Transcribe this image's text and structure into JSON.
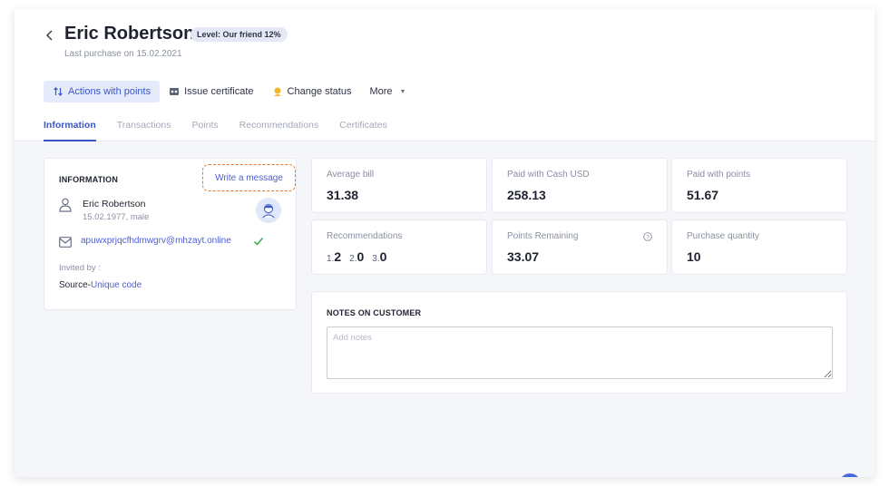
{
  "customer": {
    "name": "Eric Robertson",
    "level": "Level: Our friend 12%",
    "last_purchase": "Last purchase on 15.02.2021"
  },
  "actions": [
    {
      "label": "Actions with points",
      "icon": "sort-arrows-icon"
    },
    {
      "label": "Issue certificate",
      "icon": "certificate-icon"
    },
    {
      "label": "Change status",
      "icon": "status-icon"
    },
    {
      "label": "More",
      "icon": "caret-down-icon"
    }
  ],
  "tabs": [
    {
      "label": "Information",
      "active": true
    },
    {
      "label": "Transactions"
    },
    {
      "label": "Points"
    },
    {
      "label": "Recommendations"
    },
    {
      "label": "Certificates"
    }
  ],
  "info": {
    "title": "INFORMATION",
    "write_message": "Write a message",
    "name": "Eric Robertson",
    "dob_gender": "15.02.1977, male",
    "email": "apuwxprjqcfhdmwgrv@mhzayt.online",
    "invited_by": "Invited by :",
    "source_prefix": "Source-",
    "source_link": "Unique code"
  },
  "stats": {
    "average_bill": {
      "label": "Average bill",
      "value": "31.38"
    },
    "paid_cash": {
      "label": "Paid with Cash USD",
      "value": "258.13"
    },
    "paid_points": {
      "label": "Paid with points",
      "value": "51.67"
    },
    "recommendations": {
      "label": "Recommendations",
      "levels": [
        {
          "key": "1.",
          "value": "2"
        },
        {
          "key": "2.",
          "value": "0"
        },
        {
          "key": "3.",
          "value": "0"
        }
      ]
    },
    "points_remaining": {
      "label": "Points Remaining",
      "value": "33.07"
    },
    "purchase_quantity": {
      "label": "Purchase quantity",
      "value": "10"
    }
  },
  "notes": {
    "title": "NOTES ON CUSTOMER",
    "placeholder": "Add notes",
    "value": ""
  },
  "colors": {
    "accent": "#3a56c8",
    "link": "#4d5fd1",
    "highlight_border": "#e87722",
    "success": "#3aa84a"
  }
}
